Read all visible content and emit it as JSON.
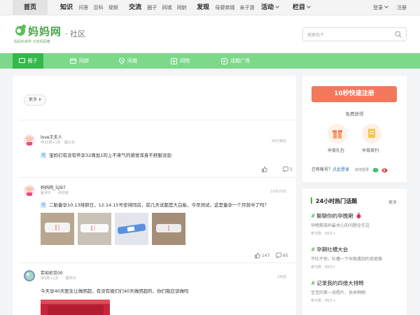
{
  "topnav": {
    "home": "首页",
    "groups": [
      {
        "main": "知识",
        "subs": [
          "问答",
          "百科",
          "视频"
        ]
      },
      {
        "main": "交流",
        "subs": [
          "圈子",
          "同城",
          "同龄"
        ]
      },
      {
        "main": "发现",
        "subs": [
          "母婴商城",
          "亲子游"
        ]
      }
    ],
    "activity": "活动",
    "column": "栏目",
    "login": "登录",
    "register": "注册"
  },
  "header": {
    "logo_text": "妈妈网",
    "logo_sub": "· 社区",
    "slogan": "妈妈的世界 只有妈妈懂",
    "search_placeholder": "搜索帖子"
  },
  "greenbar": [
    "圈子",
    "同龄",
    "同城",
    "同院",
    "话题广场"
  ],
  "main": {
    "more_label": "更多",
    "posts": [
      {
        "name": "love王夫人",
        "meta": "孕33周+1天　圈口本",
        "time": "39分钟前",
        "title": "宝妈们有没有怀孕32周加1的上不来气的感觉浑身不舒服没劲",
        "likes": "",
        "comments": "5"
      },
      {
        "name": "妈妈网_5jl97",
        "meta": "备孕中　　孕前宫",
        "time": "10月29日",
        "title": "二胎备孕10.13排卵日，12.14.15号安排同房，前几天试都是大白板，今早测试，这是备孕一个月就中了吗？",
        "likes": "147",
        "comments": "65"
      },
      {
        "name": "若如初见00",
        "meta": "孕5周+1天　　圈孕月",
        "time": "2天前",
        "title": "今天孕40天医生让做阴超，有没有姐们们40天做阴超的，你们我应该做吗",
        "likes": "",
        "comments": ""
      }
    ]
  },
  "sidebar": {
    "register_button": "10秒快速注册",
    "free_get": "免费获得",
    "gift1": "孕育礼包",
    "gift2": "孕育周刊",
    "has_account": "已有帐号？",
    "click_login": "点此登录",
    "other_login": "其他登录",
    "hot_title": "24小时热门话题",
    "hot_more": "更多",
    "hot_items": [
      {
        "title": "聊聊你的孕晚期",
        "desc": "孕晚期准妈最关心的问题全在这",
        "count": "参与数：99万+"
      },
      {
        "title": "孕期吐槽大会",
        "desc": "不吐不快，吐槽一下孕期遇到的奇葩事",
        "count": "参与数：99万+"
      },
      {
        "title": "记录我的四维大排畸",
        "desc": "宝宝的第一张照片，快来晒晒",
        "count": "参与数：99万+"
      }
    ]
  },
  "colors": {
    "brand_green": "#4aa84a",
    "nav_green": "#7cd98a",
    "register_orange": "#f2785b"
  }
}
